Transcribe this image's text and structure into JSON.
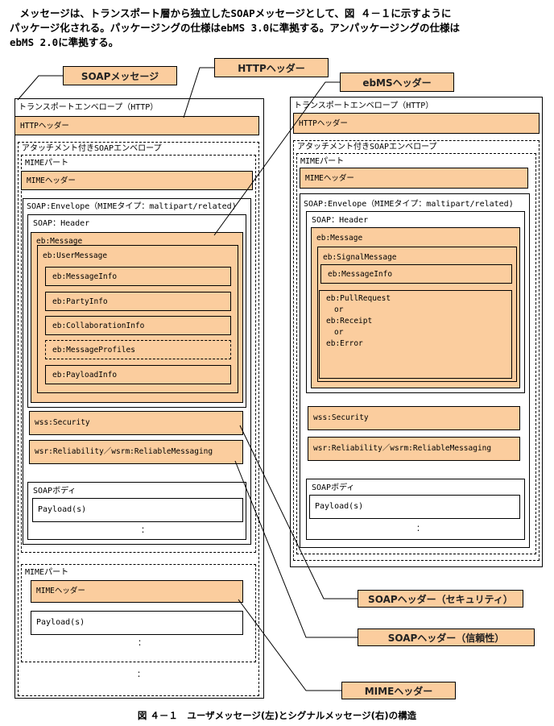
{
  "intro_text": "　メッセージは、トランスポート層から独立したSOAPメッセージとして、図 ４－１に示すように\nパッケージ化される。パッケージングの仕様はebMS 3.0に準拠する。アンパッケージングの仕様は\nebMS 2.0に準拠する。",
  "callouts": {
    "soap_message": "SOAPメッセージ",
    "http_header": "HTTPヘッダー",
    "ebms_header": "ebMSヘッダー",
    "soap_header_security": "SOAPヘッダー（セキュリティ）",
    "soap_header_reliability": "SOAPヘッダー（信頼性）",
    "mime_header": "MIMEヘッダー"
  },
  "left": {
    "transport_envelope": "トランスポートエンベロープ（HTTP）",
    "http_header": "HTTPヘッダー",
    "attachment_envelope": "アタッチメント付きSOAPエンベロープ",
    "mime_part": "MIMEパート",
    "mime_header": "MIMEヘッダー",
    "soap_envelope": "SOAP:Envelope（MIMEタイプ：maltipart/related)",
    "soap_header": "SOAP：Header",
    "eb_message": "eb:Message",
    "eb_user_message": "eb:UserMessage",
    "eb_message_info": "eb:MessageInfo",
    "eb_party_info": "eb:PartyInfo",
    "eb_collaboration_info": "eb:CollaborationInfo",
    "eb_message_profiles": "eb:MessageProfiles",
    "eb_payload_info": "eb:PayloadInfo",
    "wss_security": "wss:Security",
    "wsr_reliability": "wsr:Reliability／wsrm:ReliableMessaging",
    "soap_body": "SOAPボディ",
    "payload": "Payload(s)",
    "ellipsis": "：",
    "mime_part2": "MIMEパート",
    "mime_header2": "MIMEヘッダー",
    "payload2": "Payload(s)",
    "ellipsis2": "：",
    "ellipsis3": "："
  },
  "right": {
    "transport_envelope": "トランスポートエンベロープ（HTTP）",
    "http_header": "HTTPヘッダー",
    "attachment_envelope": "アタッチメント付きSOAPエンベロープ",
    "mime_part": "MIMEパート",
    "mime_header": "MIMEヘッダー",
    "soap_envelope": "SOAP:Envelope（MIMEタイプ：maltipart/related)",
    "soap_header": "SOAP：Header",
    "eb_message": "eb:Message",
    "eb_signal_message": "eb:SignalMessage",
    "eb_message_info": "eb:MessageInfo",
    "signal_line1": "eb:PullRequest",
    "signal_line2": "or",
    "signal_line3": "eb:Receipt",
    "signal_line4": "or",
    "signal_line5": "eb:Error",
    "wss_security": "wss:Security",
    "wsr_reliability": "wsr:Reliability／wsrm:ReliableMessaging",
    "soap_body": "SOAPボディ",
    "payload": "Payload(s)",
    "ellipsis": "："
  },
  "caption": "図 ４－１　ユーザメッセージ(左)とシグナルメッセージ(右)の構造"
}
